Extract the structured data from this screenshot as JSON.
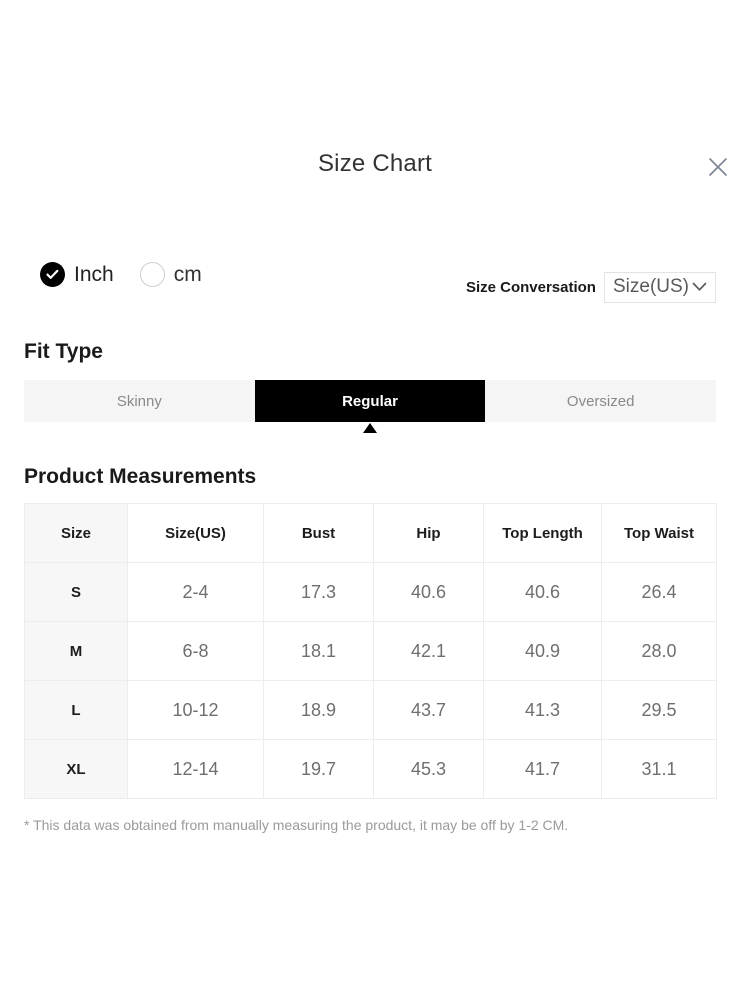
{
  "modal": {
    "title": "Size Chart",
    "close_icon": "close-icon"
  },
  "units": {
    "options": [
      {
        "label": "Inch",
        "selected": true,
        "icon": "radio-checked-icon"
      },
      {
        "label": "cm",
        "selected": false,
        "icon": "radio-unchecked-icon"
      }
    ]
  },
  "conversion": {
    "label": "Size Conversation",
    "selected": "Size(US)",
    "chevron_icon": "chevron-down-icon"
  },
  "fit_type": {
    "title": "Fit Type",
    "tabs": [
      {
        "label": "Skinny",
        "active": false
      },
      {
        "label": "Regular",
        "active": true
      },
      {
        "label": "Oversized",
        "active": false
      }
    ],
    "pointer_icon": "caret-up-icon"
  },
  "measurements": {
    "title": "Product Measurements",
    "columns": [
      "Size",
      "Size(US)",
      "Bust",
      "Hip",
      "Top Length",
      "Top Waist"
    ],
    "rows": [
      {
        "size": "S",
        "size_us": "2-4",
        "bust": "17.3",
        "hip": "40.6",
        "top_length": "40.6",
        "top_waist": "26.4"
      },
      {
        "size": "M",
        "size_us": "6-8",
        "bust": "18.1",
        "hip": "42.1",
        "top_length": "40.9",
        "top_waist": "28.0"
      },
      {
        "size": "L",
        "size_us": "10-12",
        "bust": "18.9",
        "hip": "43.7",
        "top_length": "41.3",
        "top_waist": "29.5"
      },
      {
        "size": "XL",
        "size_us": "12-14",
        "bust": "19.7",
        "hip": "45.3",
        "top_length": "41.7",
        "top_waist": "31.1"
      }
    ]
  },
  "footnote": "* This data was obtained from manually measuring the product, it may be off by 1-2 CM.",
  "colors": {
    "accent": "#000000",
    "text_primary": "#1d1d1d",
    "text_secondary": "#6f6f6f",
    "muted": "#9a9a9a",
    "tab_bg": "#f5f5f5",
    "row_head_bg": "#f7f7f7",
    "border": "#ededed"
  }
}
